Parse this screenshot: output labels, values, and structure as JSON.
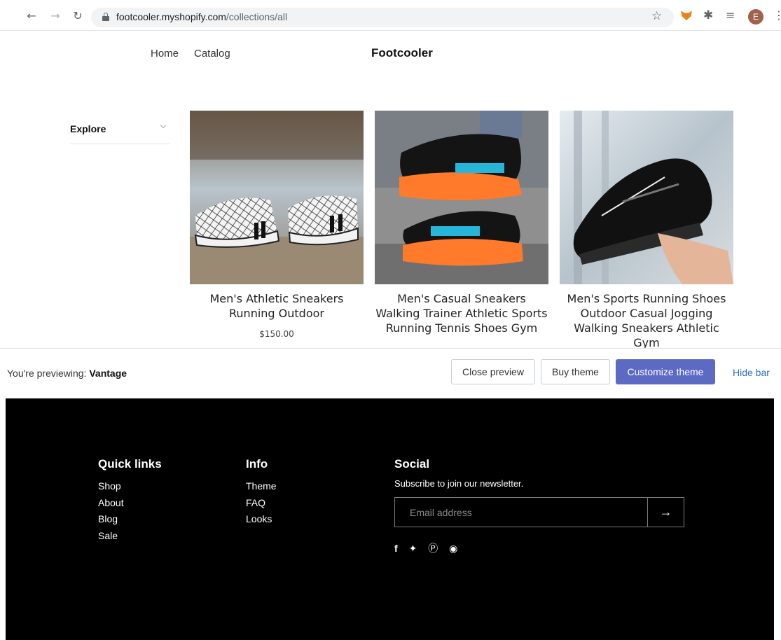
{
  "browser": {
    "url_host": "footcooler.myshopify.com",
    "url_path": "/collections/all",
    "avatar_letter": "E",
    "icons": [
      "back-icon",
      "forward-icon",
      "reload-icon",
      "lock-icon",
      "star-icon",
      "metamask-extension-icon",
      "extensions-puzzle-icon",
      "reading-list-icon",
      "profile-avatar",
      "menu-kebab-icon"
    ]
  },
  "header": {
    "nav": [
      "Home",
      "Catalog"
    ],
    "store_name": "Footcooler"
  },
  "sidebar": {
    "explore_label": "Explore"
  },
  "products": [
    {
      "title": "Men's Athletic Sneakers Running Outdoor",
      "price": "$150.00"
    },
    {
      "title": "Men's Casual Sneakers Walking Trainer Athletic Sports Running Tennis Shoes Gym",
      "price": ""
    },
    {
      "title": "Men's Sports Running Shoes Outdoor Casual Jogging Walking Sneakers Athletic Gym",
      "price": ""
    }
  ],
  "preview_bar": {
    "prefix": "You're previewing:",
    "theme_name": "Vantage",
    "close_label": "Close preview",
    "buy_label": "Buy theme",
    "customize_label": "Customize theme",
    "hide_label": "Hide bar",
    "primary_color": "#5c6ac4"
  },
  "footer": {
    "quick_links": {
      "heading": "Quick links",
      "items": [
        "Shop",
        "About",
        "Blog",
        "Sale"
      ]
    },
    "info": {
      "heading": "Info",
      "items": [
        "Theme",
        "FAQ",
        "Looks"
      ]
    },
    "social": {
      "heading": "Social",
      "newsletter_text": "Subscribe to join our newsletter.",
      "email_placeholder": "Email address",
      "icons": [
        "facebook-icon",
        "twitter-icon",
        "pinterest-icon",
        "instagram-icon"
      ]
    }
  }
}
